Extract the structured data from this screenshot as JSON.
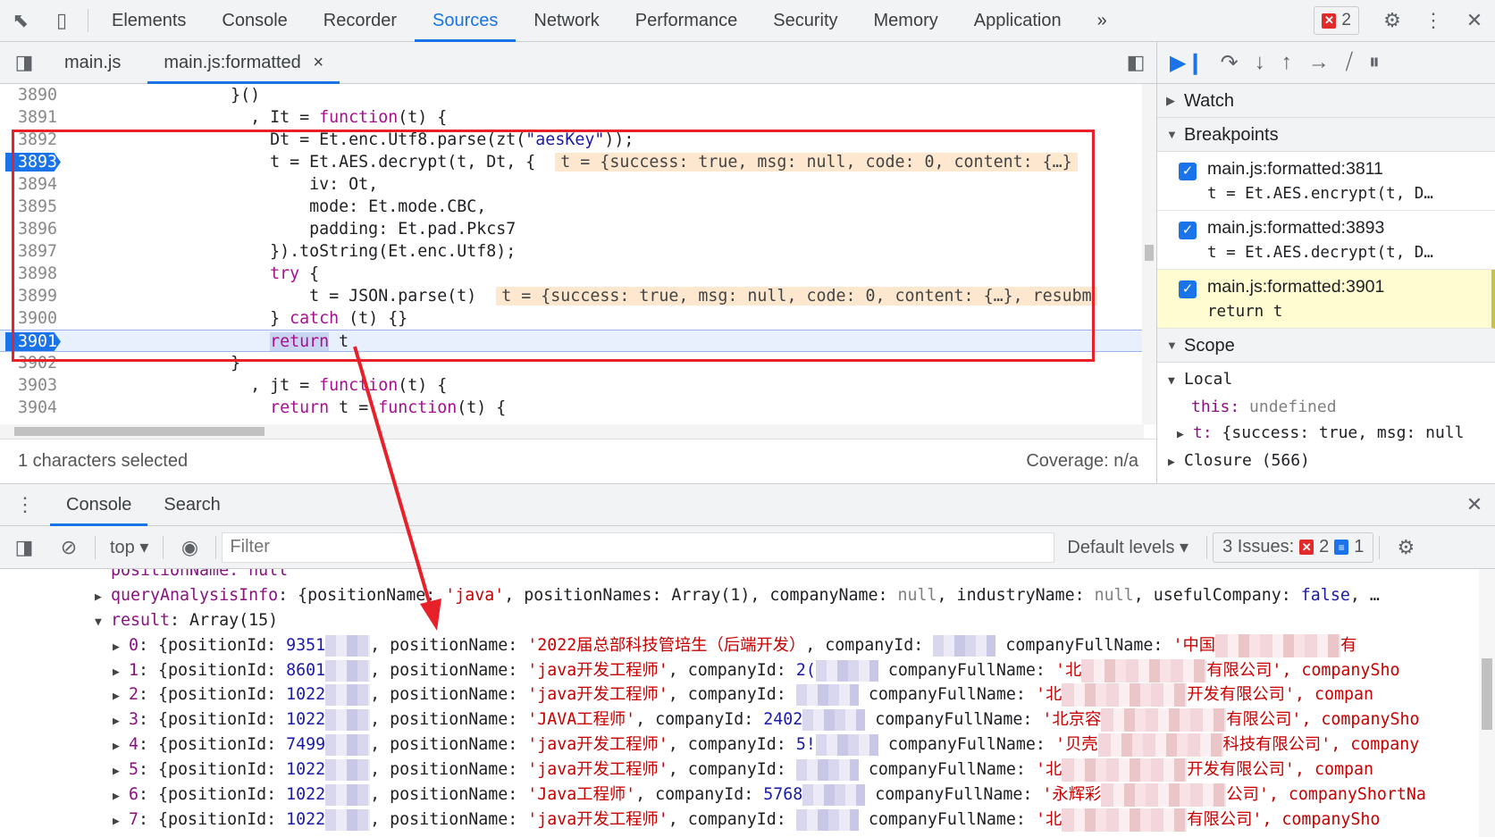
{
  "topbar": {
    "tabs": [
      "Elements",
      "Console",
      "Recorder",
      "Sources",
      "Network",
      "Performance",
      "Security",
      "Memory",
      "Application"
    ],
    "active": "Sources",
    "more": "»",
    "error_count": "2"
  },
  "files": {
    "tabs": [
      "main.js",
      "main.js:formatted"
    ],
    "active": "main.js:formatted",
    "close": "×"
  },
  "code": {
    "lines": [
      {
        "n": "3890",
        "t": [
          [
            "plain",
            "                }()"
          ]
        ]
      },
      {
        "n": "3891",
        "t": [
          [
            "plain",
            "                  , It = "
          ],
          [
            "kw",
            "function"
          ],
          [
            "plain",
            "(t) {"
          ]
        ]
      },
      {
        "n": "3892",
        "t": [
          [
            "plain",
            "                    Dt = Et.enc.Utf8.parse(zt("
          ],
          [
            "str",
            "\"aesKey\""
          ],
          [
            "plain",
            "));"
          ]
        ]
      },
      {
        "n": "3893",
        "bp": true,
        "t": [
          [
            "plain",
            "                    t = Et.AES.decrypt(t, Dt, {"
          ]
        ],
        "inline": "t = {success: true, msg: null, code: 0, content: {…}"
      },
      {
        "n": "3894",
        "t": [
          [
            "plain",
            "                        iv: Ot,"
          ]
        ]
      },
      {
        "n": "3895",
        "t": [
          [
            "plain",
            "                        mode: Et.mode.CBC,"
          ]
        ]
      },
      {
        "n": "3896",
        "t": [
          [
            "plain",
            "                        padding: Et.pad.Pkcs7"
          ]
        ]
      },
      {
        "n": "3897",
        "t": [
          [
            "plain",
            "                    }).toString(Et.enc.Utf8);"
          ]
        ]
      },
      {
        "n": "3898",
        "t": [
          [
            "plain",
            "                    "
          ],
          [
            "kw",
            "try"
          ],
          [
            "plain",
            " {"
          ]
        ]
      },
      {
        "n": "3899",
        "t": [
          [
            "plain",
            "                        t = JSON.parse(t)"
          ]
        ],
        "inline": "t = {success: true, msg: null, code: 0, content: {…}, resubm"
      },
      {
        "n": "3900",
        "t": [
          [
            "plain",
            "                    } "
          ],
          [
            "kw",
            "catch"
          ],
          [
            "plain",
            " (t) {}"
          ]
        ]
      },
      {
        "n": "3901",
        "bp": true,
        "exec": true,
        "t": [
          [
            "plain",
            "                    "
          ],
          [
            "kwhl",
            "return"
          ],
          [
            "plain",
            " t"
          ]
        ]
      },
      {
        "n": "3902",
        "t": [
          [
            "plain",
            "                }"
          ]
        ]
      },
      {
        "n": "3903",
        "t": [
          [
            "plain",
            "                  , jt = "
          ],
          [
            "kw",
            "function"
          ],
          [
            "plain",
            "(t) {"
          ]
        ]
      },
      {
        "n": "3904",
        "t": [
          [
            "plain",
            "                    "
          ],
          [
            "kw",
            "return"
          ],
          [
            "plain",
            " t = "
          ],
          [
            "kw",
            "function"
          ],
          [
            "plain",
            "(t) {"
          ]
        ]
      }
    ]
  },
  "status": {
    "left": "1 characters selected",
    "right": "Coverage: n/a"
  },
  "right": {
    "watch": "Watch",
    "breakpoints": "Breakpoints",
    "bps": [
      {
        "label": "main.js:formatted:3811",
        "src": "t = Et.AES.encrypt(t, D…"
      },
      {
        "label": "main.js:formatted:3893",
        "src": "t = Et.AES.decrypt(t, D…"
      },
      {
        "label": "main.js:formatted:3901",
        "src": "return t",
        "current": true
      }
    ],
    "scope": "Scope",
    "local": "Local",
    "this_key": "this:",
    "this_val": "undefined",
    "t_key": "t:",
    "t_val": "{success: true, msg: null",
    "closure": "Closure (566)"
  },
  "drawer": {
    "tabs": [
      "Console",
      "Search"
    ],
    "active": "Console"
  },
  "ctool": {
    "context": "top",
    "filter_placeholder": "Filter",
    "levels": "Default levels",
    "issues": "3 Issues:",
    "issues_err": "2",
    "issues_info": "1"
  },
  "console": {
    "r0": "positionName: null",
    "r1_key": "queryAnalysisInfo",
    "r1": ": {positionName: ",
    "r1_s": "'java'",
    "r1_b": ", positionNames: Array(1), companyName: ",
    "r1_n1": "null",
    "r1_c": ", industryName: ",
    "r1_n2": "null",
    "r1_d": ", usefulCompany: ",
    "r1_f": "false",
    "r1_e": ", …",
    "r2_key": "result",
    "r2": ": Array(15)",
    "items": [
      {
        "i": "0",
        "id": "9351",
        "name": "'2022届总部科技管培生（后端开发）",
        "cid": "",
        "cfn": "'中国",
        "tail": "有"
      },
      {
        "i": "1",
        "id": "8601",
        "name": "'java开发工程师'",
        "cid": "2(",
        "cfn": "'北",
        "tail": "有限公司', companySho"
      },
      {
        "i": "2",
        "id": "1022",
        "name": "'java开发工程师'",
        "cid": "",
        "cfn": "'北",
        "tail": "开发有限公司', compan"
      },
      {
        "i": "3",
        "id": "1022",
        "name": "'JAVA工程师'",
        "cid": "2402",
        "cfn": "'北京容",
        "tail": "有限公司', companySho"
      },
      {
        "i": "4",
        "id": "7499",
        "name": "'java开发工程师'",
        "cid": "5!",
        "cfn": "'贝壳",
        "tail": "科技有限公司', company"
      },
      {
        "i": "5",
        "id": "1022",
        "name": "'java开发工程师'",
        "cid": "",
        "cfn": "'北",
        "tail": "开发有限公司', compan"
      },
      {
        "i": "6",
        "id": "1022",
        "name": "'Java工程师'",
        "cid": "5768",
        "cfn": "'永辉彩",
        "tail": "公司', companyShortNa"
      },
      {
        "i": "7",
        "id": "1022",
        "name": "'java开发工程师'",
        "cid": "",
        "cfn": "'北",
        "tail": "有限公司', companySho"
      }
    ],
    "pid": "positionId: ",
    "pn": "positionName: ",
    "cidk": "companyId: ",
    "cfnk": "companyFullName: "
  },
  "colors": {
    "accent": "#1a73e8",
    "annotation": "#e8202a"
  }
}
